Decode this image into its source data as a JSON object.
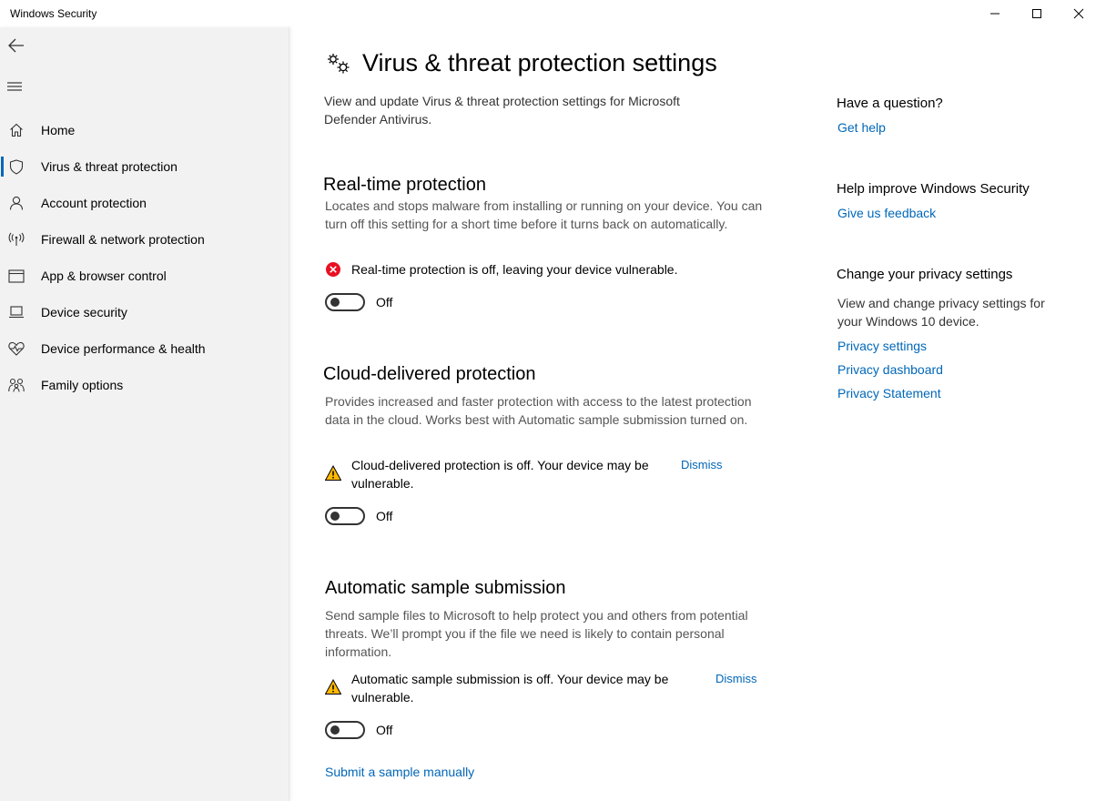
{
  "window": {
    "title": "Windows Security"
  },
  "sidebar": {
    "items": [
      {
        "label": "Home",
        "icon": "home-icon"
      },
      {
        "label": "Virus & threat protection",
        "icon": "shield-icon",
        "active": true
      },
      {
        "label": "Account protection",
        "icon": "person-icon"
      },
      {
        "label": "Firewall & network protection",
        "icon": "wireless-icon"
      },
      {
        "label": "App & browser control",
        "icon": "app-window-icon"
      },
      {
        "label": "Device security",
        "icon": "laptop-icon"
      },
      {
        "label": "Device performance & health",
        "icon": "heart-pulse-icon"
      },
      {
        "label": "Family options",
        "icon": "family-icon"
      }
    ]
  },
  "main": {
    "title": "Virus & threat protection settings",
    "description": "View and update Virus & threat protection settings for Microsoft Defender Antivirus.",
    "sections": [
      {
        "title": "Real-time protection",
        "description": "Locates and stops malware from installing or running on your device. You can turn off this setting for a short time before it turns back on automatically.",
        "alert": "Real-time protection is off, leaving your device vulnerable.",
        "alert_type": "error",
        "toggle_label": "Off",
        "toggle_on": false
      },
      {
        "title": "Cloud-delivered protection",
        "description": "Provides increased and faster protection with access to the latest protection data in the cloud. Works best with Automatic sample submission turned on.",
        "alert": "Cloud-delivered protection is off. Your device may be vulnerable.",
        "alert_type": "warning",
        "dismiss": "Dismiss",
        "toggle_label": "Off",
        "toggle_on": false
      },
      {
        "title": "Automatic sample submission",
        "description": "Send sample files to Microsoft to help protect you and others from potential threats. We’ll prompt you if the file we need is likely to contain personal information.",
        "alert": "Automatic sample submission is off. Your device may be vulnerable.",
        "alert_type": "warning",
        "dismiss": "Dismiss",
        "toggle_label": "Off",
        "toggle_on": false
      }
    ],
    "submit_link": "Submit a sample manually"
  },
  "right": {
    "question_heading": "Have a question?",
    "get_help": "Get help",
    "improve_heading": "Help improve Windows Security",
    "feedback": "Give us feedback",
    "privacy_heading": "Change your privacy settings",
    "privacy_text": "View and change privacy settings for your Windows 10 device.",
    "privacy_settings": "Privacy settings",
    "privacy_dashboard": "Privacy dashboard",
    "privacy_statement": "Privacy Statement"
  },
  "colors": {
    "accent": "#0067b8",
    "error": "#e81123",
    "warning": "#ffb900",
    "sidebar_bg": "#f2f2f2"
  }
}
